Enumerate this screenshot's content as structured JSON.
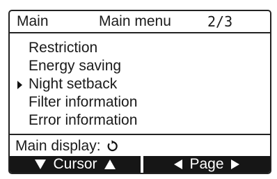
{
  "header": {
    "left": "Main",
    "title": "Main menu",
    "page": "2/3"
  },
  "menu": {
    "items": [
      {
        "label": "Restriction"
      },
      {
        "label": "Energy saving"
      },
      {
        "label": "Night setback",
        "selected": true
      },
      {
        "label": "Filter information"
      },
      {
        "label": "Error information"
      }
    ]
  },
  "status": {
    "label": "Main display:",
    "icon": "return-icon"
  },
  "footer": {
    "cursor_label": "Cursor",
    "page_label": "Page"
  }
}
